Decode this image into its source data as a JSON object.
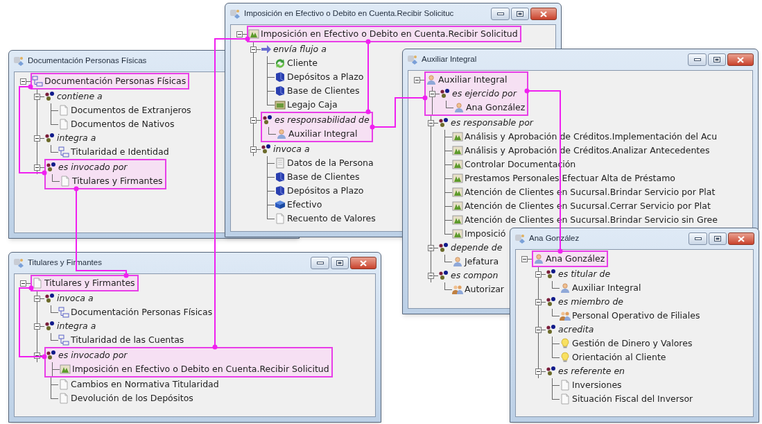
{
  "windows": [
    {
      "title": "Documentación Personas Físicas",
      "tree": {
        "label": "Documentación Personas Físicas",
        "kind": "structure",
        "highlighted": true,
        "expanded": true,
        "children": [
          {
            "label": "contiene a",
            "kind": "relation",
            "highlighted": false,
            "expanded": true,
            "children": [
              {
                "label": "Documentos de Extranjeros",
                "kind": "document",
                "highlighted": false
              },
              {
                "label": "Documentos de Nativos",
                "kind": "document",
                "highlighted": false
              }
            ]
          },
          {
            "label": "integra a",
            "kind": "relation",
            "highlighted": false,
            "expanded": true,
            "children": [
              {
                "label": "Titularidad e Identidad",
                "kind": "structure",
                "highlighted": false
              }
            ]
          },
          {
            "label": "es invocado por",
            "kind": "relation",
            "highlighted": true,
            "expanded": true,
            "children": [
              {
                "label": "Titulares y Firmantes",
                "kind": "document",
                "highlighted": true
              }
            ]
          }
        ]
      }
    },
    {
      "title": "Imposición en Efectivo o Debito en Cuenta.Recibir Solicituc",
      "tree": {
        "label": "Imposición en Efectivo o Debito en Cuenta.Recibir Solicitud",
        "kind": "process",
        "highlighted": true,
        "expanded": true,
        "children": [
          {
            "label": "envía flujo a",
            "kind": "flow",
            "highlighted": false,
            "expanded": true,
            "children": [
              {
                "label": "Cliente",
                "kind": "money",
                "highlighted": false
              },
              {
                "label": "Depósitos a Plazo",
                "kind": "database",
                "highlighted": false
              },
              {
                "label": "Base de Clientes",
                "kind": "database",
                "highlighted": false
              },
              {
                "label": "Legajo Caja",
                "kind": "folder",
                "highlighted": false
              }
            ]
          },
          {
            "label": "es responsabilidad de",
            "kind": "relation",
            "highlighted": true,
            "expanded": true,
            "children": [
              {
                "label": "Auxiliar Integral",
                "kind": "person",
                "highlighted": true
              }
            ]
          },
          {
            "label": "invoca a",
            "kind": "relation",
            "highlighted": false,
            "expanded": true,
            "children": [
              {
                "label": "Datos de la Persona",
                "kind": "form",
                "highlighted": false
              },
              {
                "label": "Base de Clientes",
                "kind": "database",
                "highlighted": false
              },
              {
                "label": "Depósitos a Plazo",
                "kind": "database",
                "highlighted": false
              },
              {
                "label": "Efectivo",
                "kind": "cash",
                "highlighted": false
              },
              {
                "label": "Recuento de Valores",
                "kind": "document",
                "highlighted": false
              }
            ]
          }
        ]
      }
    },
    {
      "title": "Auxiliar Integral",
      "tree": {
        "label": "Auxiliar Integral",
        "kind": "person",
        "highlighted": true,
        "expanded": true,
        "children": [
          {
            "label": "es ejercido por",
            "kind": "relation",
            "highlighted": true,
            "expanded": true,
            "children": [
              {
                "label": "Ana González",
                "kind": "person",
                "highlighted": true
              }
            ]
          },
          {
            "label": "es responsable por",
            "kind": "relation",
            "highlighted": false,
            "expanded": true,
            "children": [
              {
                "label": "Análisis y Aprobación de Créditos.Implementación del Acu",
                "kind": "process",
                "highlighted": false
              },
              {
                "label": "Análisis y Aprobación de Créditos.Analizar Antecedentes",
                "kind": "process",
                "highlighted": false
              },
              {
                "label": "Controlar Documentación",
                "kind": "process",
                "highlighted": false
              },
              {
                "label": "Prestamos Personales.Efectuar Alta de Préstamo",
                "kind": "process",
                "highlighted": false
              },
              {
                "label": "Atención de Clientes en Sucursal.Brindar Servicio por Plat",
                "kind": "process",
                "highlighted": false
              },
              {
                "label": "Atención de Clientes en Sucursal.Cerrar Servicio por Plat",
                "kind": "process",
                "highlighted": false
              },
              {
                "label": "Atención de Clientes en Sucursal.Brindar Servicio sin Gree",
                "kind": "process",
                "highlighted": false
              },
              {
                "label": "Imposició",
                "kind": "process",
                "highlighted": false
              }
            ]
          },
          {
            "label": "depende de",
            "kind": "relation",
            "highlighted": false,
            "expanded": true,
            "children": [
              {
                "label": "Jefatura",
                "kind": "person",
                "highlighted": false
              }
            ]
          },
          {
            "label": "es compon",
            "kind": "relation",
            "highlighted": false,
            "expanded": true,
            "children": [
              {
                "label": "Autorizar",
                "kind": "group",
                "highlighted": false
              }
            ]
          }
        ]
      }
    },
    {
      "title": "Titulares y Firmantes",
      "tree": {
        "label": "Titulares y Firmantes",
        "kind": "document",
        "highlighted": true,
        "expanded": true,
        "children": [
          {
            "label": "invoca a",
            "kind": "relation",
            "highlighted": false,
            "expanded": true,
            "children": [
              {
                "label": "Documentación Personas Físicas",
                "kind": "structure",
                "highlighted": false
              }
            ]
          },
          {
            "label": "integra a",
            "kind": "relation",
            "highlighted": false,
            "expanded": true,
            "children": [
              {
                "label": "Titularidad de las Cuentas",
                "kind": "structure",
                "highlighted": false
              }
            ]
          },
          {
            "label": "es invocado por",
            "kind": "relation",
            "highlighted": true,
            "expanded": true,
            "children": [
              {
                "label": "Imposición en Efectivo o Debito en Cuenta.Recibir Solicitud",
                "kind": "process",
                "highlighted": true
              },
              {
                "label": "Cambios en Normativa Titularidad",
                "kind": "document",
                "highlighted": false
              },
              {
                "label": "Devolución de los Depósitos",
                "kind": "document",
                "highlighted": false
              }
            ]
          }
        ]
      }
    },
    {
      "title": "Ana González",
      "tree": {
        "label": "Ana González",
        "kind": "person",
        "highlighted": true,
        "expanded": true,
        "children": [
          {
            "label": "es titular de",
            "kind": "relation",
            "highlighted": false,
            "expanded": true,
            "children": [
              {
                "label": "Auxiliar Integral",
                "kind": "person",
                "highlighted": false
              }
            ]
          },
          {
            "label": "es miembro de",
            "kind": "relation",
            "highlighted": false,
            "expanded": true,
            "children": [
              {
                "label": "Personal Operativo de Filiales",
                "kind": "group",
                "highlighted": false
              }
            ]
          },
          {
            "label": "acredita",
            "kind": "relation",
            "highlighted": false,
            "expanded": true,
            "children": [
              {
                "label": "Gestión de Dinero y Valores",
                "kind": "lightbulb",
                "highlighted": false
              },
              {
                "label": "Orientación al Cliente",
                "kind": "lightbulb",
                "highlighted": false
              }
            ]
          },
          {
            "label": "es referente en",
            "kind": "relation",
            "highlighted": false,
            "expanded": true,
            "children": [
              {
                "label": "Inversiones",
                "kind": "document",
                "highlighted": false
              },
              {
                "label": "Situación Fiscal del Inversor",
                "kind": "document",
                "highlighted": false
              }
            ]
          }
        ]
      }
    }
  ]
}
